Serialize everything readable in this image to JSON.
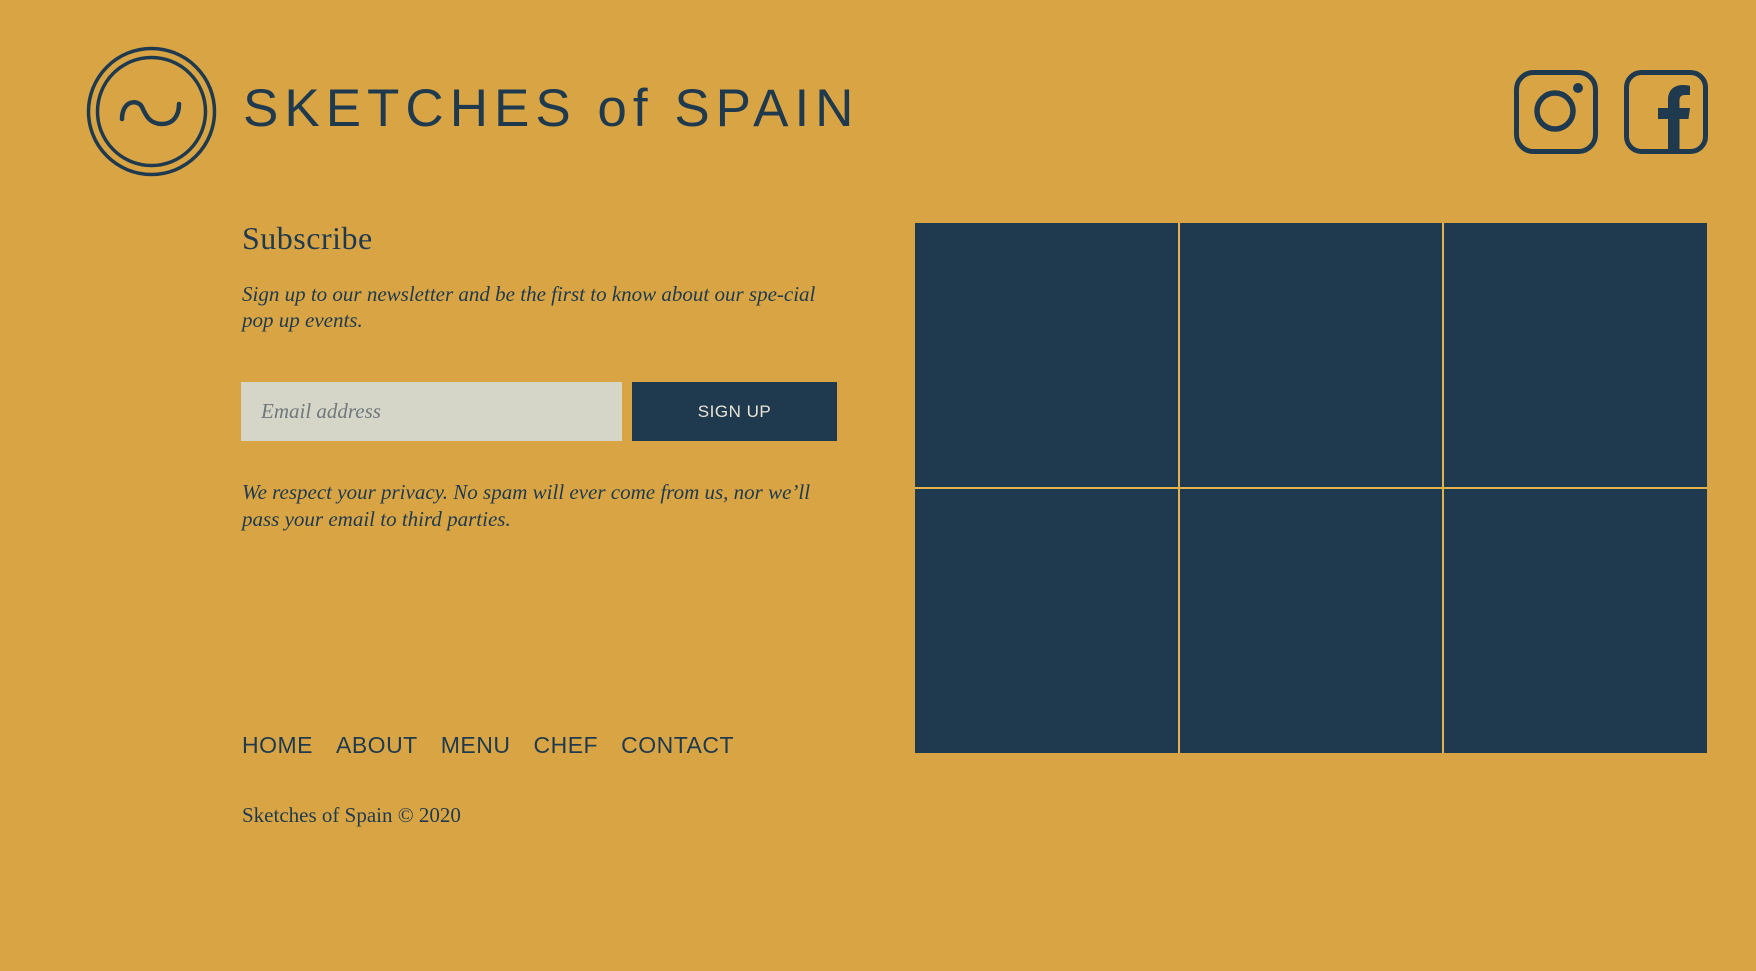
{
  "brand": {
    "title": "SKETCHES of SPAIN",
    "logo_icon": "circle-s-logo-icon"
  },
  "social": {
    "instagram_icon": "instagram-icon",
    "facebook_icon": "facebook-icon"
  },
  "subscribe": {
    "title": "Subscribe",
    "description": "Sign up to our newsletter and be the first to know about our spe-cial pop up events.",
    "email_placeholder": "Email address",
    "email_value": "",
    "button_label": "SIGN UP",
    "privacy_note": "We respect your privacy. No spam will ever come from us, nor we’ll pass your email to third parties."
  },
  "nav": {
    "items": [
      {
        "label": "HOME"
      },
      {
        "label": "ABOUT"
      },
      {
        "label": "MENU"
      },
      {
        "label": "CHEF"
      },
      {
        "label": "CONTACT"
      }
    ]
  },
  "footer": {
    "copyright": "Sketches of Spain © 2020"
  },
  "gallery": {
    "tile_count": 6
  },
  "colors": {
    "background": "#D9A544",
    "navy": "#1F3A4E",
    "input_bg": "#D5D6C7",
    "button_text": "#E9E4D6"
  }
}
